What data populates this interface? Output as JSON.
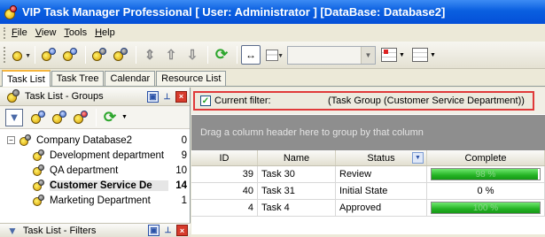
{
  "window": {
    "title": "VIP Task Manager Professional [ User: Administrator ] [DataBase: Database2]"
  },
  "menu": [
    {
      "key": "F",
      "rest": "ile"
    },
    {
      "key": "V",
      "rest": "iew"
    },
    {
      "key": "T",
      "rest": "ools"
    },
    {
      "key": "H",
      "rest": "elp"
    }
  ],
  "tabs": [
    "Task List",
    "Task Tree",
    "Calendar",
    "Resource List"
  ],
  "groups_pane": {
    "title": "Task List - Groups",
    "tree": [
      {
        "label": "Company Database2",
        "count": "0"
      },
      {
        "label": "Development department",
        "count": "9"
      },
      {
        "label": "QA department",
        "count": "10"
      },
      {
        "label": "Customer Service De",
        "count": "14"
      },
      {
        "label": "Marketing Department",
        "count": "1"
      }
    ]
  },
  "filters_pane": {
    "title": "Task List - Filters"
  },
  "filter_bar": {
    "label": "Current filter:",
    "text": "(Task Group  (Customer Service Department))",
    "checked": true
  },
  "group_zone": {
    "text": "Drag a column header here to group by that column"
  },
  "grid": {
    "columns": [
      "ID",
      "Name",
      "Status",
      "Complete"
    ],
    "rows": [
      {
        "id": "39",
        "name": "Task 30",
        "status": "Review",
        "complete": 98,
        "complete_text": "98 %"
      },
      {
        "id": "40",
        "name": "Task 31",
        "status": "Initial State",
        "complete": 0,
        "complete_text": "0 %"
      },
      {
        "id": "4",
        "name": "Task 4",
        "status": "Approved",
        "complete": 100,
        "complete_text": "100 %"
      }
    ]
  },
  "colors": {
    "filter_outline": "#e03a3a",
    "progress_fill": "#24b324",
    "title_bar": "#0a5fe0"
  }
}
